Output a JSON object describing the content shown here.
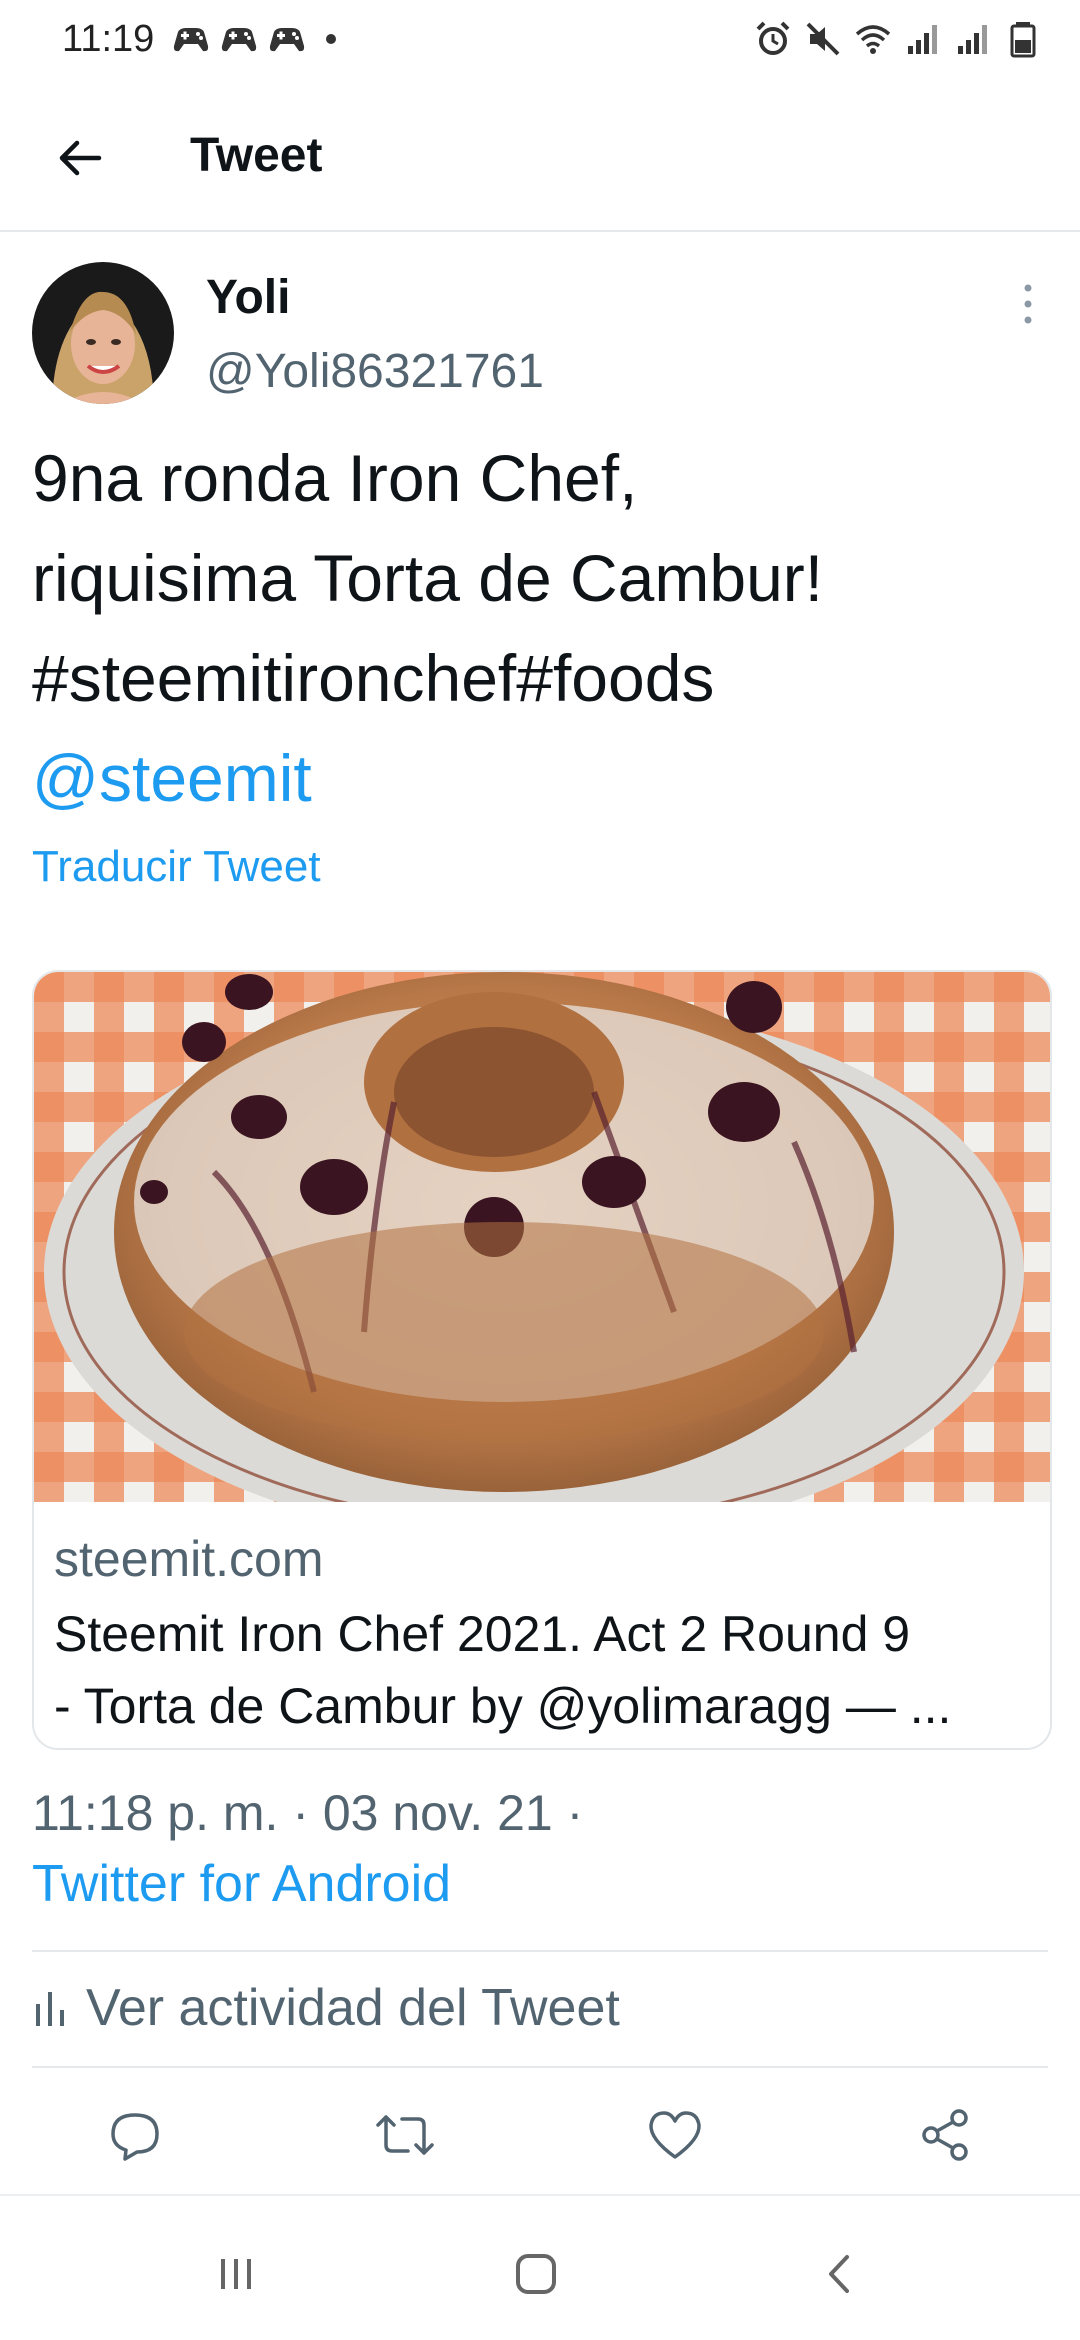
{
  "status_bar": {
    "time": "11:19",
    "notification_icons": [
      "game-controller-icon",
      "game-controller-icon",
      "game-controller-icon"
    ],
    "system_icons": [
      "alarm-icon",
      "mute-icon",
      "wifi-icon",
      "signal-icon",
      "signal-icon",
      "battery-icon"
    ]
  },
  "header": {
    "title": "Tweet"
  },
  "tweet": {
    "author_name": "Yoli",
    "author_handle": "@Yoli86321761",
    "text_lines": [
      "9na ronda Iron Chef,",
      "riquisima Torta de Cambur!",
      "#steemitironchef#foods"
    ],
    "mention": "@steemit",
    "translate_label": "Traducir Tweet",
    "timestamp": "11:18 p. m. · 03 nov. 21 ·",
    "source": "Twitter for Android",
    "activity_label": "Ver actividad del Tweet"
  },
  "card": {
    "domain": "steemit.com",
    "title_lines": [
      "Steemit Iron Chef 2021. Act 2 Round 9",
      "- Torta de Cambur by @yolimaragg — ..."
    ]
  },
  "colors": {
    "accent": "#1d9bf0",
    "muted": "#536471",
    "text": "#0f1419",
    "divider": "#e6e9eb"
  }
}
